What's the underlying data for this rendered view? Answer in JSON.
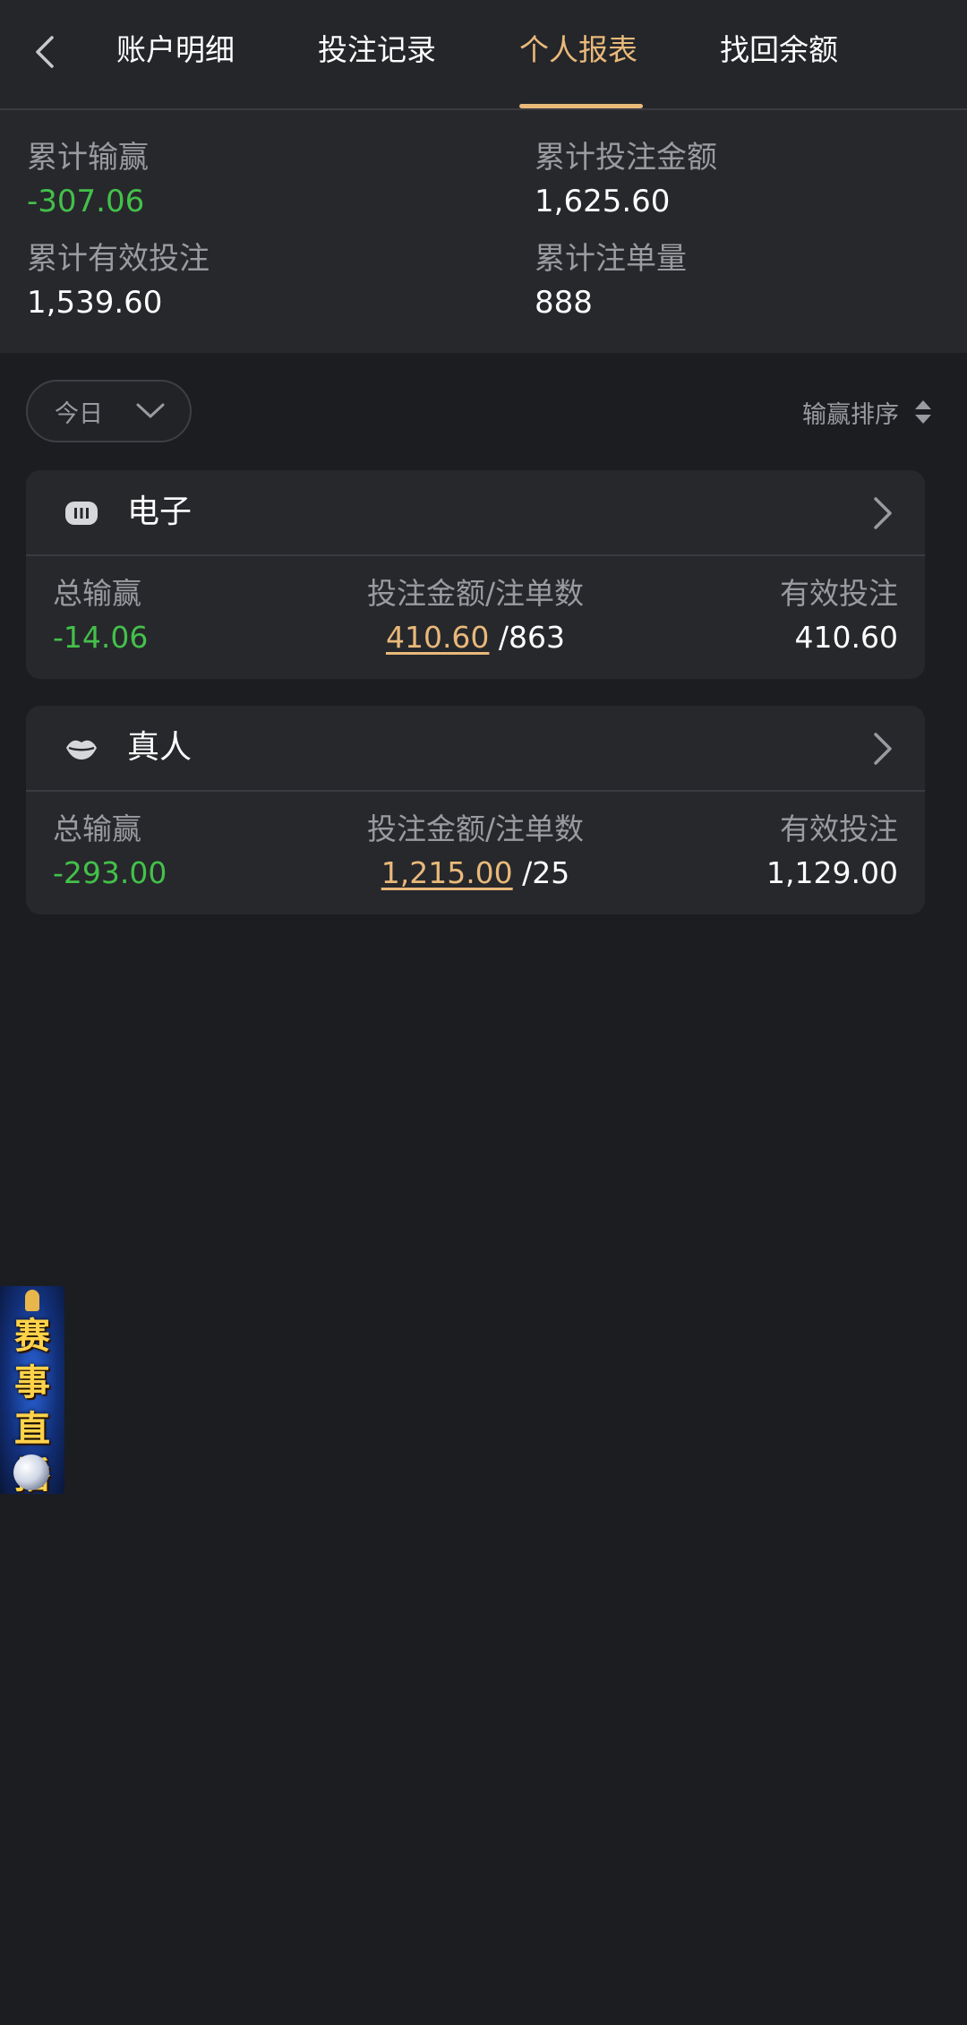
{
  "nav": {
    "back_icon": "chevron-left-icon",
    "tabs": [
      {
        "label": "账户明细",
        "active": false
      },
      {
        "label": "投注记录",
        "active": false
      },
      {
        "label": "个人报表",
        "active": true
      },
      {
        "label": "找回余额",
        "active": false
      }
    ]
  },
  "summary": {
    "win_loss_label": "累计输赢",
    "win_loss_value": "-307.06",
    "bet_amount_label": "累计投注金额",
    "bet_amount_value": "1,625.60",
    "valid_bet_label": "累计有效投注",
    "valid_bet_value": "1,539.60",
    "order_count_label": "累计注单量",
    "order_count_value": "888"
  },
  "filter": {
    "period": "今日",
    "sort_label": "输赢排序"
  },
  "categories": [
    {
      "title": "电子",
      "icon": "slot-machine-icon",
      "win_loss_label": "总输赢",
      "win_loss": "-14.06",
      "bet_label": "投注金额/注单数",
      "bet_amount": "410.60",
      "bet_count": "/863",
      "valid_label": "有效投注",
      "valid_bet": "410.60"
    },
    {
      "title": "真人",
      "icon": "lips-icon",
      "win_loss_label": "总输赢",
      "win_loss": "-293.00",
      "bet_label": "投注金额/注单数",
      "bet_amount": "1,215.00",
      "bet_count": "/25",
      "valid_label": "有效投注",
      "valid_bet": "1,129.00"
    }
  ],
  "promo": {
    "text": "赛事直播"
  },
  "colors": {
    "accent": "#e9b97a",
    "negative": "#43c14a",
    "background": "#1c1d21",
    "card": "#27282c"
  }
}
